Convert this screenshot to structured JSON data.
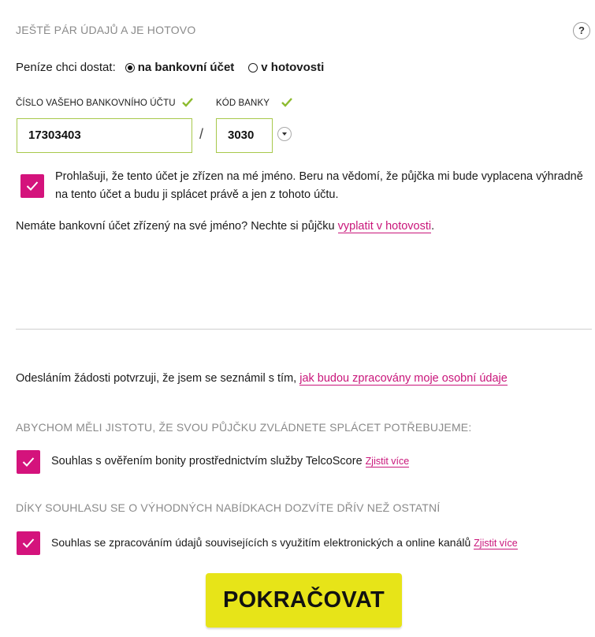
{
  "header": {
    "title": "JEŠTĚ PÁR ÚDAJŮ A JE HOTOVO",
    "help_label": "?"
  },
  "payout": {
    "prompt": "Peníze chci dostat:",
    "options": [
      {
        "label": "na bankovní účet",
        "selected": true
      },
      {
        "label": "v hotovosti",
        "selected": false
      }
    ]
  },
  "account": {
    "number_label": "ČÍSLO VAŠEHO BANKOVNÍHO ÚČTU",
    "number_value": "17303403",
    "separator": "/",
    "bank_label": "KÓD BANKY",
    "bank_value": "3030",
    "valid_color": "#8dbb2f"
  },
  "declaration": {
    "checked": true,
    "text": "Prohlašuji, že tento účet je zřízen na mé jméno. Beru na vědomí, že půjčka mi bude vyplacena výhradně na tento účet a budu ji splácet právě a jen z tohoto účtu."
  },
  "no_account": {
    "text": "Nemáte bankovní účet zřízený na své jméno? Nechte si půjčku ",
    "link": "vyplatit v hotovosti",
    "suffix": "."
  },
  "consent": {
    "text": "Odesláním žádosti potvrzuji, že jsem se seznámil s tím, ",
    "link": "jak budou zpracovány moje osobní údaje"
  },
  "section_scoring": {
    "title": "ABYCHOM MĚLI JISTOTU, ŽE SVOU PŮJČKU ZVLÁDNETE SPLÁCET POTŘEBUJEME:",
    "checked": true,
    "text": "Souhlas s ověřením bonity prostřednictvím služby TelcoScore ",
    "link": "Zjistit více"
  },
  "section_offers": {
    "title": "DÍKY SOUHLASU SE O VÝHODNÝCH NABÍDKACH DOZVÍTE DŘÍV NEŽ OSTATNÍ",
    "checked": true,
    "text": "Souhlas se zpracováním údajů souvisejících s využitím elektronických a online kanálů ",
    "link": "Zjistit více"
  },
  "cta": {
    "label": "POKRAČOVAT",
    "color": "#e7e418"
  },
  "colors": {
    "accent": "#d4137c",
    "link": "#c9157a"
  }
}
